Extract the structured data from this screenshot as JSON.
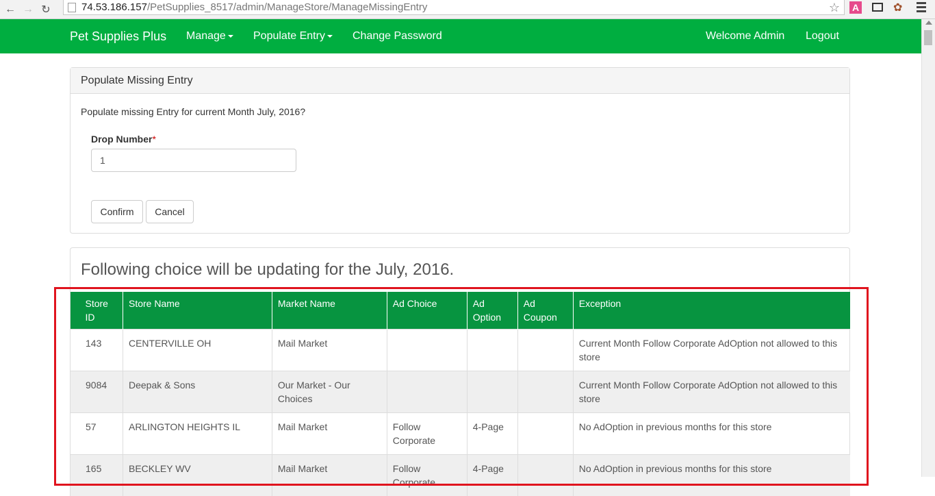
{
  "browser": {
    "url_host": "74.53.186.157",
    "url_path": "/PetSupplies_8517/admin/ManageStore/ManageMissingEntry"
  },
  "navbar": {
    "brand": "Pet Supplies Plus",
    "menu": [
      "Manage",
      "Populate Entry",
      "Change Password"
    ],
    "welcome": "Welcome Admin",
    "logout": "Logout"
  },
  "panel1": {
    "heading": "Populate Missing Entry",
    "question": "Populate missing Entry for current Month July, 2016?",
    "field_label": "Drop Number",
    "required_mark": "*",
    "field_value": "1",
    "confirm": "Confirm",
    "cancel": "Cancel"
  },
  "panel2": {
    "title": "Following choice will be updating for the July, 2016."
  },
  "table": {
    "headers": [
      [
        "Store",
        "ID"
      ],
      [
        "Store Name"
      ],
      [
        "Market Name"
      ],
      [
        "Ad Choice"
      ],
      [
        "Ad",
        "Option"
      ],
      [
        "Ad",
        "Coupon"
      ],
      [
        "Exception"
      ]
    ],
    "rows": [
      {
        "store_id": "143",
        "store_name": "CENTERVILLE OH",
        "market": [
          "Mail Market"
        ],
        "ad_choice": [],
        "ad_option": "",
        "ad_coupon": "",
        "exception": [
          "Current Month Follow Corporate AdOption not allowed to this",
          "store"
        ]
      },
      {
        "store_id": "9084",
        "store_name": "Deepak & Sons",
        "market": [
          "Our Market - Our",
          "Choices"
        ],
        "ad_choice": [],
        "ad_option": "",
        "ad_coupon": "",
        "exception": [
          "Current Month Follow Corporate AdOption not allowed to this",
          "store"
        ]
      },
      {
        "store_id": "57",
        "store_name": "ARLINGTON HEIGHTS IL",
        "market": [
          "Mail Market"
        ],
        "ad_choice": [
          "Follow",
          "Corporate"
        ],
        "ad_option": "4-Page",
        "ad_coupon": "",
        "exception": [
          "No AdOption in previous months for this store"
        ]
      },
      {
        "store_id": "165",
        "store_name": "BECKLEY WV",
        "market": [
          "Mail Market"
        ],
        "ad_choice": [
          "Follow",
          "Corporate"
        ],
        "ad_option": "4-Page",
        "ad_coupon": "",
        "exception": [
          "No AdOption in previous months for this store"
        ]
      }
    ]
  },
  "colors": {
    "navbar": "#00ae40",
    "table_header": "#079440",
    "highlight": "#e0141e"
  }
}
